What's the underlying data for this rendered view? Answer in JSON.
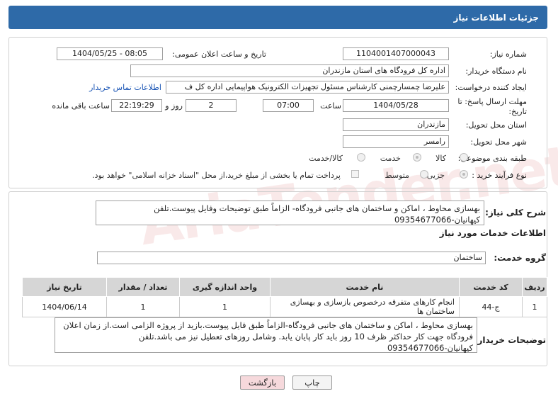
{
  "header": {
    "title": "جزئیات اطلاعات نیاز"
  },
  "form": {
    "need_number_label": "شماره نیاز:",
    "need_number": "1104001407000043",
    "announce_label": "تاریخ و ساعت اعلان عمومی:",
    "announce_value": "1404/05/25 - 08:05",
    "buyer_org_label": "نام دستگاه خریدار:",
    "buyer_org": "اداره کل فرودگاه های استان مازندران",
    "requester_label": "ایجاد کننده درخواست:",
    "requester": "علیرضا چمسارچمنی کارشناس مسئول تجهیزات الکترونیک هواپیمایی اداره کل ف",
    "contact_link": "اطلاعات تماس خریدار",
    "deadline_label": "مهلت ارسال پاسخ: تا تاریخ:",
    "deadline_date": "1404/05/28",
    "time_label": "ساعت",
    "deadline_time": "07:00",
    "days_value": "2",
    "days_label": "روز و",
    "remaining_time": "22:19:29",
    "remaining_label": "ساعت باقی مانده",
    "province_label": "استان محل تحویل:",
    "province": "مازندران",
    "city_label": "شهر محل تحویل:",
    "city": "رامسر",
    "category_label": "طبقه بندی موضوعی:",
    "category_options": [
      "کالا",
      "خدمت",
      "کالا/خدمت"
    ],
    "category_selected": "خدمت",
    "process_label": "نوع فرآیند خرید :",
    "process_options": [
      "جزیی",
      "متوسط"
    ],
    "process_selected": "جزیی",
    "payment_note": "پرداخت تمام یا بخشی از مبلغ خرید،از محل \"اسناد خزانه اسلامی\" خواهد بود."
  },
  "summary": {
    "label": "شرح کلی نیاز:",
    "text": "بهسازی محاوط ، اماکن و ساختمان های جانبی فرودگاه- الزاماً طبق توضیحات وفایل پیوست.تلفن کیهانیان-09354677066"
  },
  "services": {
    "heading": "اطلاعات خدمات مورد نیاز",
    "group_label": "گروه خدمت:",
    "group_value": "ساختمان",
    "columns": [
      "ردیف",
      "کد خدمت",
      "نام خدمت",
      "واحد اندازه گیری",
      "تعداد / مقدار",
      "تاریخ نیاز"
    ],
    "rows": [
      [
        "1",
        "ج-44",
        "انجام کارهای متفرقه درخصوص بازسازی و بهسازی ساختمان ها",
        "1",
        "1",
        "1404/06/14"
      ]
    ]
  },
  "buyer_notes": {
    "label": "توضیحات خریدار:",
    "text": "بهسازی محاوط ، اماکن و ساختمان های جانبی فرودگاه-الزاماً طبق فایل پیوست.بازید از پروژه الزامی است.از زمان اعلان فرودگاه جهت کار حداکثر ظرف 10 روز باید کار پایان یابد. وشامل روزهای تعطیل نیز می باشد.تلفن کیهانیان-09354677066"
  },
  "buttons": {
    "print": "چاپ",
    "back": "بازگشت"
  },
  "watermark": "AriaTender.net"
}
